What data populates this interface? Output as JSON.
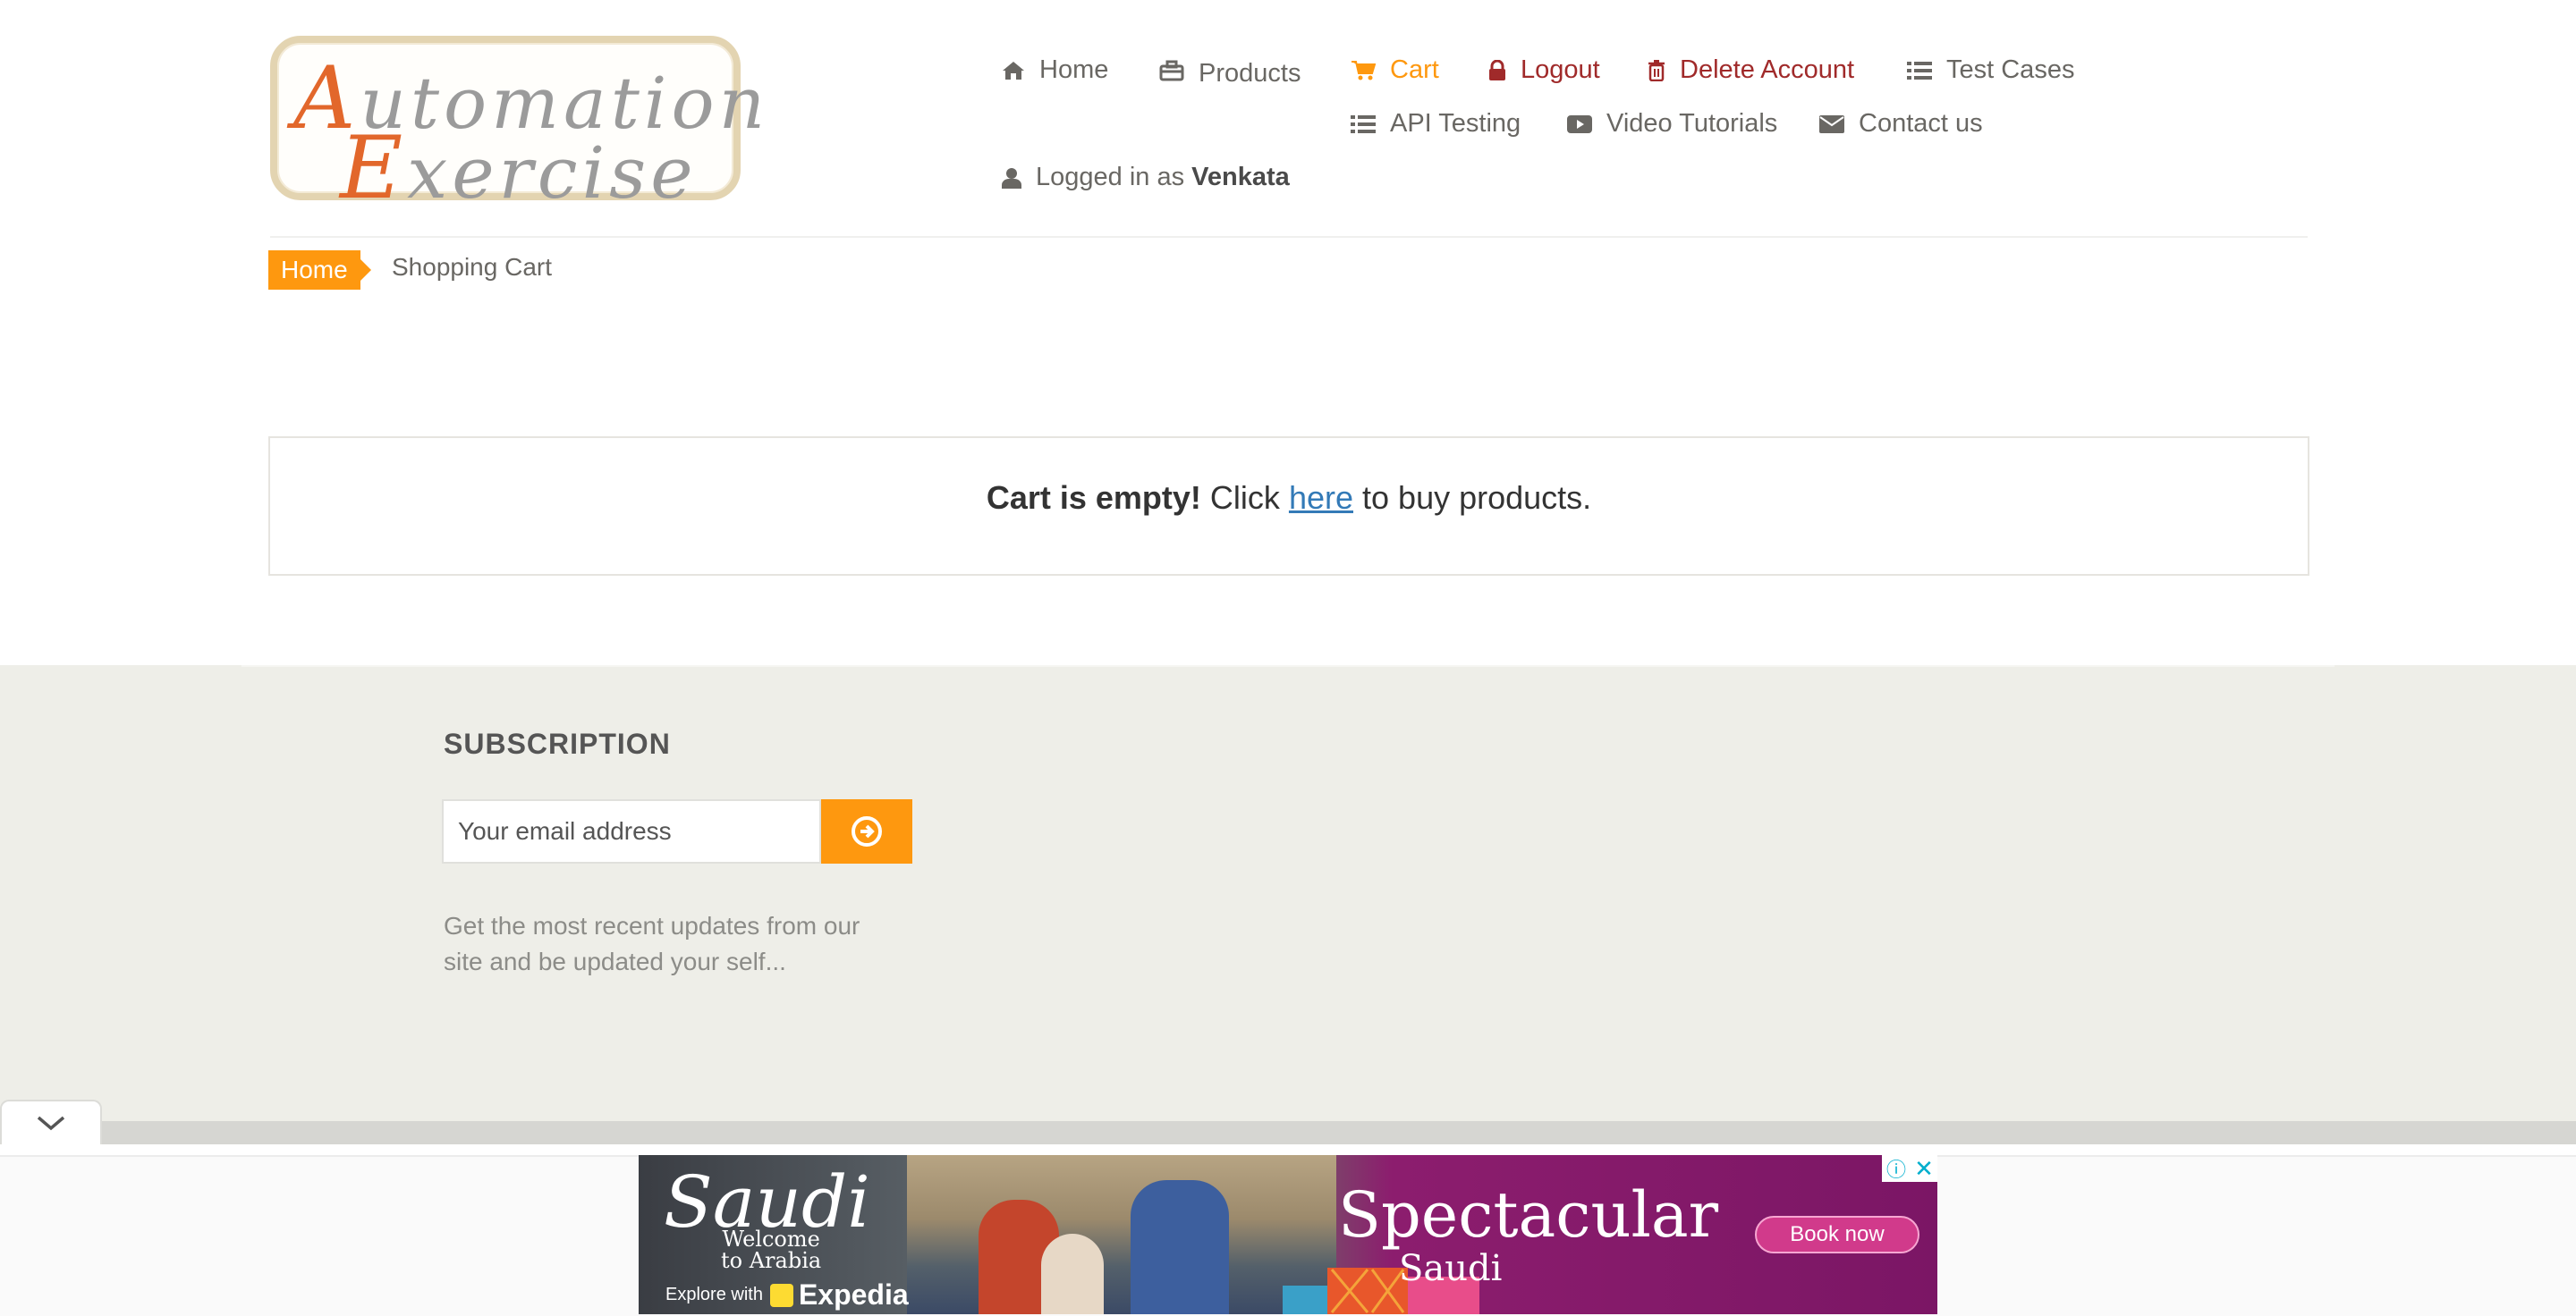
{
  "logo": {
    "line1_cap": "A",
    "line1_rest": "utomation",
    "line2_cap": "E",
    "line2_rest": "xercise"
  },
  "nav": {
    "home": "Home",
    "products": "Products",
    "cart": "Cart",
    "logout": "Logout",
    "delete_account": "Delete Account",
    "test_cases": "Test Cases",
    "api_testing": "API Testing",
    "video_tutorials": "Video Tutorials",
    "contact_us": "Contact us",
    "logged_in_prefix": "Logged in as",
    "username": "Venkata"
  },
  "breadcrumb": {
    "home": "Home",
    "current": "Shopping Cart"
  },
  "cart": {
    "empty_bold": "Cart is empty!",
    "click": "Click",
    "link": "here",
    "suffix": "to buy products."
  },
  "footer": {
    "subscription_title": "SUBSCRIPTION",
    "email_placeholder": "Your email address",
    "subscription_text": "Get the most recent updates from our site and be updated your self..."
  },
  "ad": {
    "brand": "Saudi",
    "welcome_line1": "Welcome",
    "welcome_line2": "to Arabia",
    "explore_prefix": "Explore with",
    "explore_brand": "Expedia",
    "headline": "Spectacular",
    "sub": "Saudi",
    "cta": "Book now",
    "info": "ⓘ",
    "close": "✕"
  },
  "colors": {
    "accent": "#fe980f",
    "danger": "#a02a2a",
    "link": "#337ab7",
    "footer_bg": "#eeeee8"
  },
  "icons": [
    "home-icon",
    "briefcase-icon",
    "cart-icon",
    "lock-icon",
    "trash-icon",
    "list-icon",
    "play-icon",
    "envelope-icon",
    "user-icon",
    "arrow-circle-right-icon",
    "chevron-down-icon"
  ]
}
